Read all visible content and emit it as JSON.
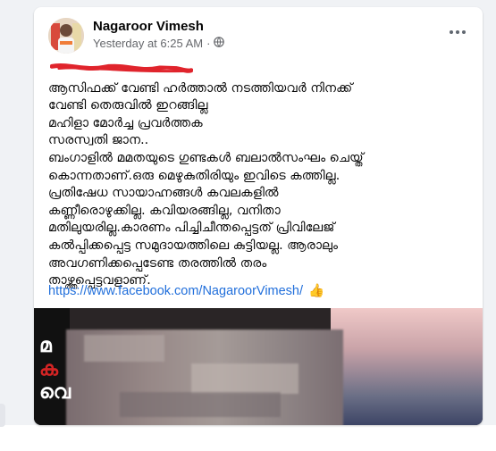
{
  "post": {
    "author": "Nagaroor Vimesh",
    "timestamp": "Yesterday at 6:25 AM",
    "separator": "·",
    "audience_icon": "globe-icon",
    "more_icon": "more-options-icon",
    "text_lines": [
      "ആസിഫക്ക് വേണ്ടി ഹർത്താൽ നടത്തിയവർ നിനക്ക്",
      "വേണ്ടി തെരുവിൽ ഇറങ്ങില്ല",
      "മഹിളാ മോർച്ച പ്രവർത്തക",
      "സരസ്വതി ജാന..",
      " ബംഗാളിൽ മമതയുടെ ഗുണ്ടകൾ ബലാൽസംഘം ചെയ്ത്",
      "കൊന്നതാണ്.ഒരു മെഴുകുതിരിയും ഇവിടെ കത്തില്ല.",
      "പ്രതിഷേധ സായാഹ്നങ്ങൾ കവലകളിൽ",
      "കണ്ണീരൊഴുക്കില്ല. കവിയരങ്ങില്ല, വനിതാ",
      "മതിലുയരില്ല.കാരണം പിച്ചിചീന്തപ്പെട്ടത് പ്രിവിലേജ്",
      "കൽപ്പിക്കപ്പെട്ട സമുദായത്തിലെ കുട്ടിയല്ല. ആരാലും",
      "അവഗണിക്കപ്പെടേണ്ട തരത്തിൽ തരം",
      "താഴ്ത്തപ്പെട്ടവളാണ്."
    ],
    "link": "https://www.facebook.com/NagaroorVimesh/",
    "link_emoji": "👍"
  },
  "media": {
    "overlay_chars": [
      "മ",
      "ക",
      "വെ"
    ]
  },
  "colors": {
    "link": "#216fdb",
    "redaction": "#e0242c",
    "card_bg": "#ffffff",
    "page_bg": "#f0f2f5"
  }
}
